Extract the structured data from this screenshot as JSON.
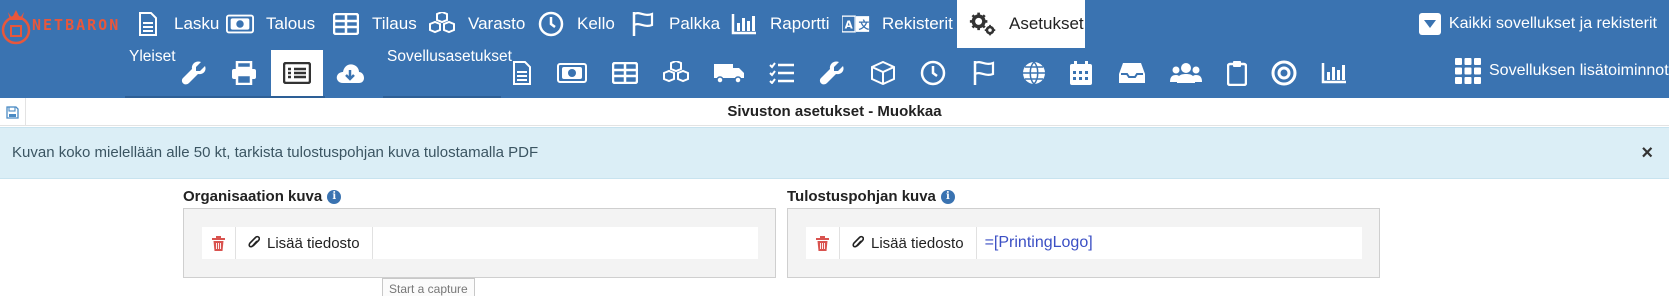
{
  "brand": {
    "logo_text": "NETBARON"
  },
  "nav": {
    "items": [
      {
        "label": "Lasku",
        "icon": "document-icon"
      },
      {
        "label": "Talous",
        "icon": "money-icon"
      },
      {
        "label": "Tilaus",
        "icon": "table-icon"
      },
      {
        "label": "Varasto",
        "icon": "cubes-icon"
      },
      {
        "label": "Kello",
        "icon": "clock-icon"
      },
      {
        "label": "Palkka",
        "icon": "flag-icon"
      },
      {
        "label": "Raportti",
        "icon": "bar-chart-icon"
      },
      {
        "label": "Rekisterit",
        "icon": "translate-icon"
      },
      {
        "label": "Asetukset",
        "icon": "gears-icon",
        "active": true
      }
    ],
    "all_apps": "Kaikki sovellukset ja rekisterit"
  },
  "subnav": {
    "general_label": "Yleiset",
    "app_settings_label": "Sovellusasetukset",
    "more_functions": "Sovelluksen lisätoiminnot"
  },
  "page": {
    "title": "Sivuston asetukset - Muokkaa"
  },
  "alert": {
    "text": "Kuvan koko mielellään alle 50 kt, tarkista tulostuspohjan kuva tulostamalla PDF",
    "close": "×"
  },
  "fields": {
    "org_image": {
      "label": "Organisaation kuva",
      "add_file": "Lisää tiedosto",
      "value": ""
    },
    "print_image": {
      "label": "Tulostuspohjan kuva",
      "add_file": "Lisää tiedosto",
      "value": "=[PrintingLogo]"
    }
  },
  "tooltip": "Start a capture",
  "colors": {
    "primary": "#3a73b1",
    "alert_bg": "#dbeef6",
    "danger": "#d9534f",
    "logo": "#e8573c"
  }
}
